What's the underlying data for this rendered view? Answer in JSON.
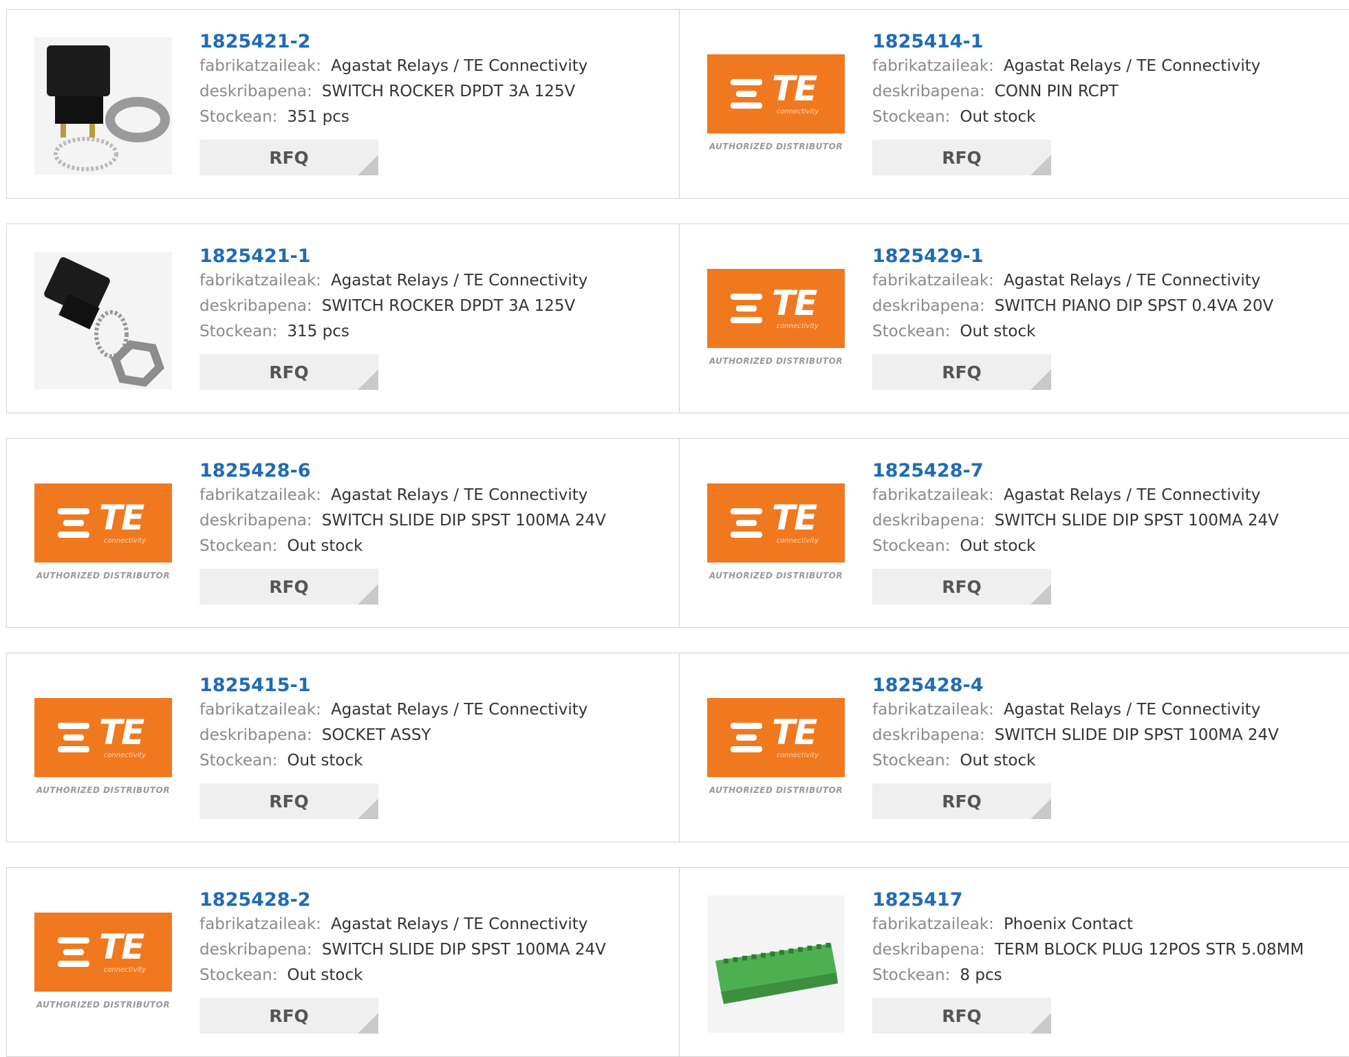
{
  "labels": {
    "manufacturer": "fabrikatzaileak:",
    "description": "deskribapena:",
    "stock": "Stockean:",
    "rfq": "RFQ"
  },
  "logo": {
    "te_text": "TE",
    "te_sub": "connectivity",
    "authorized": "AUTHORIZED DISTRIBUTOR"
  },
  "products": [
    {
      "part": "1825421-2",
      "manufacturer": "Agastat Relays / TE Connectivity",
      "description": "SWITCH ROCKER DPDT 3A 125V",
      "stock": "351 pcs",
      "image": "rocker-switch-icon"
    },
    {
      "part": "1825414-1",
      "manufacturer": "Agastat Relays / TE Connectivity",
      "description": "CONN PIN RCPT",
      "stock": "Out stock",
      "image": "te-logo"
    },
    {
      "part": "1825421-1",
      "manufacturer": "Agastat Relays / TE Connectivity",
      "description": "SWITCH ROCKER DPDT 3A 125V",
      "stock": "315 pcs",
      "image": "rocker-switch-icon"
    },
    {
      "part": "1825429-1",
      "manufacturer": "Agastat Relays / TE Connectivity",
      "description": "SWITCH PIANO DIP SPST 0.4VA 20V",
      "stock": "Out stock",
      "image": "te-logo"
    },
    {
      "part": "1825428-6",
      "manufacturer": "Agastat Relays / TE Connectivity",
      "description": "SWITCH SLIDE DIP SPST 100MA 24V",
      "stock": "Out stock",
      "image": "te-logo"
    },
    {
      "part": "1825428-7",
      "manufacturer": "Agastat Relays / TE Connectivity",
      "description": "SWITCH SLIDE DIP SPST 100MA 24V",
      "stock": "Out stock",
      "image": "te-logo"
    },
    {
      "part": "1825415-1",
      "manufacturer": "Agastat Relays / TE Connectivity",
      "description": "SOCKET ASSY",
      "stock": "Out stock",
      "image": "te-logo"
    },
    {
      "part": "1825428-4",
      "manufacturer": "Agastat Relays / TE Connectivity",
      "description": "SWITCH SLIDE DIP SPST 100MA 24V",
      "stock": "Out stock",
      "image": "te-logo"
    },
    {
      "part": "1825428-2",
      "manufacturer": "Agastat Relays / TE Connectivity",
      "description": "SWITCH SLIDE DIP SPST 100MA 24V",
      "stock": "Out stock",
      "image": "te-logo"
    },
    {
      "part": "1825417",
      "manufacturer": "Phoenix Contact",
      "description": "TERM BLOCK PLUG 12POS STR 5.08MM",
      "stock": "8 pcs",
      "image": "terminal-block-icon"
    }
  ],
  "colors": {
    "part_link": "#1f6bb6",
    "te_orange": "#f0791f",
    "terminal_green": "#4caf50"
  }
}
